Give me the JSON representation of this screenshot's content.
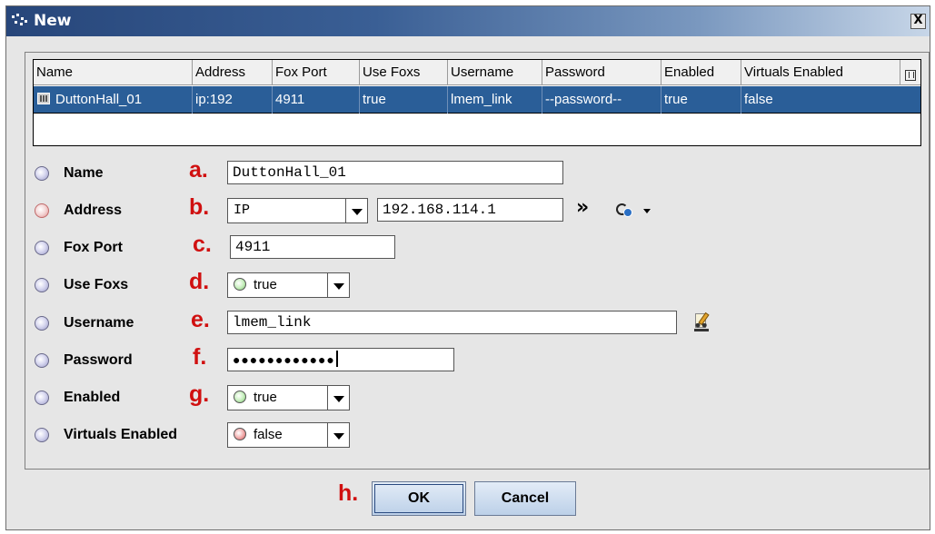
{
  "window": {
    "title": "New",
    "close_label": "X"
  },
  "grid": {
    "columns": [
      "Name",
      "Address",
      "Fox Port",
      "Use Foxs",
      "Username",
      "Password",
      "Enabled",
      "Virtuals Enabled"
    ],
    "rows": [
      {
        "name": "DuttonHall_01",
        "address": "ip:192",
        "fox_port": "4911",
        "use_foxs": "true",
        "username": "lmem_link",
        "password": "--password--",
        "enabled": "true",
        "virtuals_enabled": "false"
      }
    ]
  },
  "annotations": {
    "a": "a.",
    "b": "b.",
    "c": "c.",
    "d": "d.",
    "e": "e.",
    "f": "f.",
    "g": "g.",
    "h": "h."
  },
  "form": {
    "name": {
      "label": "Name",
      "value": "DuttonHall_01"
    },
    "address": {
      "label": "Address",
      "type": "IP",
      "value": "192.168.114.1",
      "more": "»"
    },
    "fox_port": {
      "label": "Fox Port",
      "value": "4911"
    },
    "use_foxs": {
      "label": "Use Foxs",
      "value": "true"
    },
    "username": {
      "label": "Username",
      "value": "lmem_link"
    },
    "password": {
      "label": "Password",
      "value": "●●●●●●●●●●●●"
    },
    "enabled": {
      "label": "Enabled",
      "value": "true"
    },
    "virtuals_enabled": {
      "label": "Virtuals Enabled",
      "value": "false"
    }
  },
  "buttons": {
    "ok": "OK",
    "cancel": "Cancel"
  }
}
